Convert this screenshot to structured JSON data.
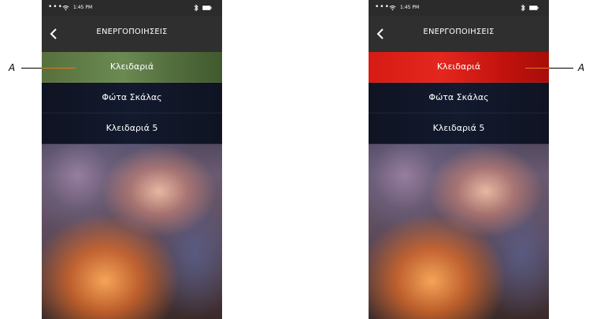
{
  "phones": {
    "left": {
      "status": {
        "time": "1:45 PM",
        "dots": "•••"
      },
      "nav": {
        "title": "ΕΝΕΡΓΟΠΟΙΗΣΕΙΣ"
      },
      "items": [
        {
          "label": "Κλειδαριά",
          "state": "active-green"
        },
        {
          "label": "Φώτα Σκάλας",
          "state": "normal"
        },
        {
          "label": "Κλειδαριά 5",
          "state": "normal"
        }
      ]
    },
    "right": {
      "status": {
        "time": "1:45 PM",
        "dots": "•••"
      },
      "nav": {
        "title": "ΕΝΕΡΓΟΠΟΙΗΣΕΙΣ"
      },
      "items": [
        {
          "label": "Κλειδαριά",
          "state": "active-red"
        },
        {
          "label": "Φώτα Σκάλας",
          "state": "normal"
        },
        {
          "label": "Κλειδαριά 5",
          "state": "normal"
        }
      ]
    }
  },
  "callouts": {
    "left": "A",
    "right": "A"
  },
  "colors": {
    "active_green": "#6b8a52",
    "active_red": "#e4271e",
    "callout_line": "#e07a1c"
  },
  "icons": {
    "back": "chevron-left-icon",
    "wifi": "wifi-icon",
    "bluetooth": "bluetooth-icon",
    "battery": "battery-icon"
  }
}
